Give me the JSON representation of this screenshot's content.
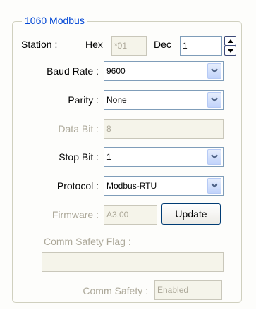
{
  "group": {
    "title": "1060 Modbus"
  },
  "station": {
    "label": "Station :",
    "hex_label": "Hex",
    "hex_value": "*01",
    "dec_label": "Dec",
    "dec_value": "1"
  },
  "baud_rate": {
    "label": "Baud Rate :",
    "value": "9600"
  },
  "parity": {
    "label": "Parity :",
    "value": "None"
  },
  "data_bit": {
    "label": "Data Bit :",
    "value": "8"
  },
  "stop_bit": {
    "label": "Stop Bit :",
    "value": "1"
  },
  "protocol": {
    "label": "Protocol :",
    "value": "Modbus-RTU"
  },
  "firmware": {
    "label": "Firmware :",
    "value": "A3.00",
    "button": "Update"
  },
  "comm_safety_flag": {
    "label": "Comm Safety Flag :",
    "value": ""
  },
  "comm_safety": {
    "label": "Comm Safety :",
    "value": "Enabled"
  },
  "icons": {
    "dropdown": "chevron-down-icon",
    "spin_up": "arrow-up-icon",
    "spin_down": "arrow-down-icon"
  }
}
